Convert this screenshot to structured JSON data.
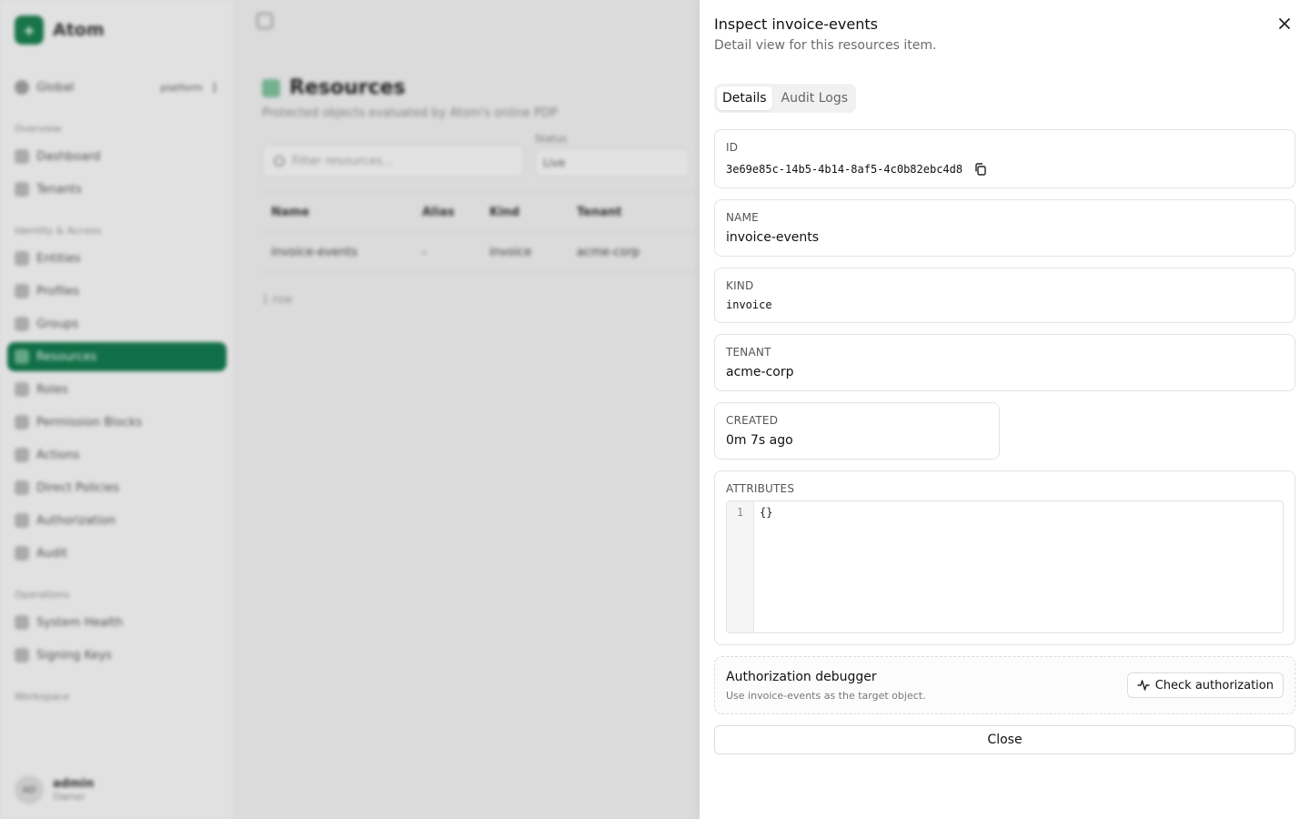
{
  "background": {
    "app_name": "Atom",
    "scope": {
      "label": "Global",
      "tenant": "platform"
    },
    "sections": [
      {
        "label": "Overview",
        "items": [
          "Dashboard",
          "Tenants"
        ]
      },
      {
        "label": "Identity & Access",
        "items": [
          "Entities",
          "Profiles",
          "Groups",
          "Resources",
          "Roles",
          "Permission Blocks",
          "Actions",
          "Direct Policies",
          "Authorization",
          "Audit"
        ]
      },
      {
        "label": "Operations",
        "items": [
          "System Health",
          "Signing Keys"
        ]
      },
      {
        "label": "Workspace",
        "items": []
      }
    ],
    "active_item": "Resources",
    "user": {
      "initials": "AD",
      "name": "admin",
      "role": "Owner"
    },
    "page": {
      "title": "Resources",
      "subtitle": "Protected objects evaluated by Atom's online PDP",
      "filter_placeholder": "Filter resources...",
      "status_label": "Status",
      "status_value": "Live",
      "columns": [
        "Name",
        "Alias",
        "Kind",
        "Tenant"
      ],
      "rows": [
        [
          "invoice-events",
          "-",
          "invoice",
          "acme-corp"
        ]
      ],
      "count": "1 row"
    }
  },
  "drawer": {
    "title": "Inspect invoice-events",
    "subtitle": "Detail view for this resources item.",
    "tabs": [
      "Details",
      "Audit Logs"
    ],
    "active_tab": "Details",
    "fields": {
      "id": {
        "label": "ID",
        "value": "3e69e85c-14b5-4b14-8af5-4c0b82ebc4d8"
      },
      "name": {
        "label": "NAME",
        "value": "invoice-events"
      },
      "kind": {
        "label": "KIND",
        "value": "invoice"
      },
      "tenant": {
        "label": "TENANT",
        "value": "acme-corp"
      },
      "created": {
        "label": "CREATED",
        "value": "0m 7s ago"
      },
      "attributes": {
        "label": "ATTRIBUTES",
        "line_number": "1",
        "code": "{}"
      }
    },
    "debugger": {
      "title": "Authorization debugger",
      "subtitle": "Use invoice-events as the target object.",
      "button": "Check authorization"
    },
    "close_button": "Close"
  },
  "colors": {
    "brand": "#12744a",
    "backdrop": "#e4e4e4",
    "drawer_bg": "#ffffff"
  },
  "icons": [
    "close-icon",
    "copy-icon",
    "activity-icon",
    "search-icon",
    "chevron-down-icon",
    "sidebar-toggle-icon"
  ]
}
